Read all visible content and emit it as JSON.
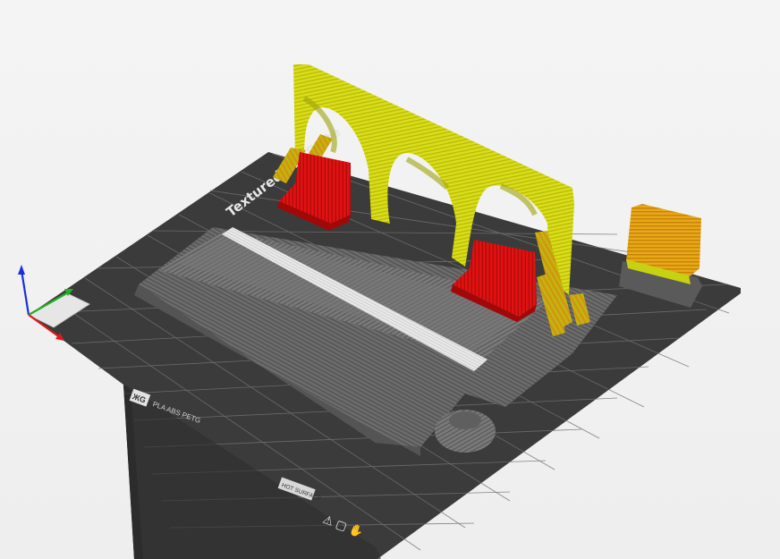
{
  "viewport": {
    "plate_brand_text": "Textured PEI Plate",
    "plate_logo_text": "ЖG",
    "plate_filament_text": "PLA ABS PETG",
    "plate_surface_text": "HOT SURFACE",
    "plate_icons_text": "⚠ ▢ ✋"
  },
  "colors": {
    "background": "#f2f2f2",
    "plate_dark": "#3b3b3b",
    "plate_grid": "#6f6f6f",
    "print_gray": "#6b6b6b",
    "support_yellow": "#d8dc14",
    "overhang_red": "#dd1010",
    "orange_block": "#e3a016",
    "axis_x": "#e01818",
    "axis_y": "#21b021",
    "axis_z": "#1a2fd6"
  },
  "icons": [
    "axis-gizmo-icon"
  ]
}
